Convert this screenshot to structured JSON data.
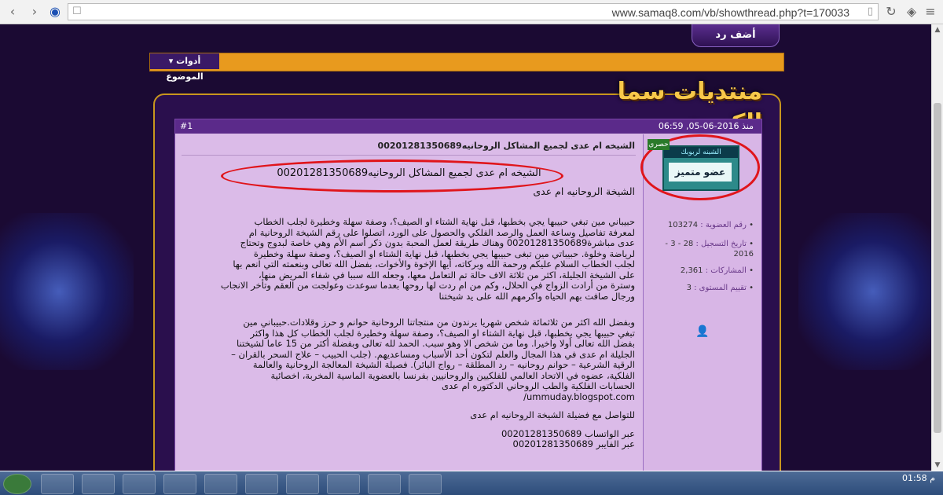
{
  "browser": {
    "url": "www.samaq8.com/vb/showthread.php?t=170033"
  },
  "forum": {
    "reply_label": "أضف رد",
    "tools_label": "أدوات الموضوع",
    "logo_text": "منتديات سما الكويت"
  },
  "post": {
    "date": "منذ 2016-06-05, 06:59",
    "number": "#1",
    "badge": "حصري",
    "title": "الشيخه ام عدى لجميع المشاكل الروحانيه00201281350689",
    "headline": "الشيخه ام عدى لجميع المشاكل الروحانيه00201281350689",
    "body_lines": [
      "الشيخة الروحانيه ام عدى",
      "",
      "حبيباني مين تبغي حبيبها يجي بخطبها، قبل نهاية الشتاء او الصيف؟، وصفة سهلة وخطيرة لجلب الخطاب",
      "لمعرفة تفاصيل وساعة العمل والرصد الفلكي والحصول على الورد، اتصلوا على رقم الشيخة الروحانية ام",
      "عدى مباشرة00201281350689 وهناك طريقة لعمل المحبة بدون ذكر أسم الأم وهي خاصة لبدوج وتحتاج",
      "لرياضة وخلوة. حبيباتي مين تبغى حبيبها يجي بخطبها، قبل نهاية الشتاء او الصيف؟، وصفة سهلة وخطيرة",
      "لجلب الخطاب السلام عليكم ورحمة الله وبركاته، أيها الإخوة والأخوات، بفضل الله تعالى وبنعمته التي انعم بها",
      "على الشيخة الجليلة، اكثر من ثلاثة الاف حالة تم التعامل معها، وجعله الله سببا في شفاء المريض منها،",
      "وسترة من أرادت الزواج في الحلال، وكم من ام ردت لها روحها بعدما سوعدت وعولجت من العقم وتأخر الانجاب",
      "ورجال صافت بهم الحياه واكرمهم الله على يد شيختنا",
      "",
      "",
      "وبفضل الله اكثر من ثلاثمائة شخص شهريا يرندون من منتجاتنا الروحانية حوانم و حرز وقلادات.حبيباني مين",
      "تبغي حبيبها يجي بخطبها، قبل نهاية الشتاء او الصيف؟، وصفة سهلة وخطيرة لجلب الخطاب كل هذا واكثر",
      "بفضل الله تعالى أولا واخيرا. وما من شخص الا وهو سبب. الحمد لله تعالى وبفضلة أكثر من 15 عاما لشيختنا",
      "الجليلة ام عدى في هذا المجال والعلم لتكون أحد الأسباب ومساعديهم. (جلب الحبيب – علاج السحر بالقران –",
      "الرقية الشرعية – حوانم روحانيه – رد المطلقة – رواج البائر). فصيلة الشيخة المعالجة الروحانية والعالمة",
      "الفلكية، عضوه في الاتحاد العالمي للفلكيين والروحانيين بفرنسا بالعضوية الماسية المخربة، اخصائية",
      "الحسابات الفلكية والطب الروحاني الدكتوره ام عدى",
      "ummuday.blogspot.com/",
      "",
      "للتواصل مع فضيلة الشيخة الروحانيه ام عدى",
      "",
      "عبر الواتساب 00201281350689",
      "عبر الفايبر 00201281350689"
    ]
  },
  "user": {
    "badge_top": "الشبنه لربوبك",
    "rank": "عضو متميز",
    "member_no_label": "رقم العضوية :",
    "member_no": "103274",
    "reg_label": "تاريخ التسجيل :",
    "reg_date": "28 - 3 - 2016",
    "posts_label": "المشاركات :",
    "posts": "2,361",
    "level_label": "تقييم المستوى :",
    "level": "3"
  },
  "taskbar": {
    "time": "01:58",
    "ampm": "م"
  }
}
